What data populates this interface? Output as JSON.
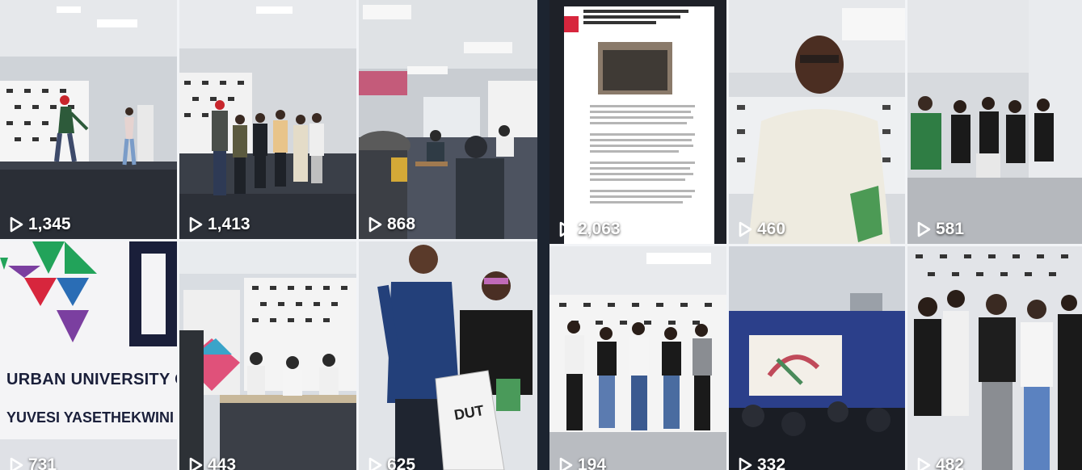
{
  "left_grid": {
    "tiles": [
      {
        "views": "1,345",
        "scene": "stage-performance"
      },
      {
        "views": "1,413",
        "scene": "stage-group"
      },
      {
        "views": "868",
        "scene": "classroom"
      },
      {
        "views": "731",
        "scene": "dut-logo",
        "banner_line1": "URBAN UNIVERSITY O",
        "banner_line2": "YUVESI YASETHEKWINI YE"
      },
      {
        "views": "443",
        "scene": "registration-table"
      },
      {
        "views": "625",
        "scene": "bag-presentation",
        "bag_text": "DUT"
      }
    ]
  },
  "right_grid": {
    "tiles": [
      {
        "views": "2,063",
        "scene": "article-screenshot"
      },
      {
        "views": "460",
        "scene": "speaker-closeup"
      },
      {
        "views": "581",
        "scene": "group-photo-1"
      },
      {
        "views": "194",
        "scene": "group-photo-2"
      },
      {
        "views": "332",
        "scene": "presentation-room"
      },
      {
        "views": "482",
        "scene": "group-photo-3"
      }
    ]
  },
  "colors": {
    "view_text": "#ffffff",
    "dut_red": "#d7263d",
    "dut_blue": "#2a6db5",
    "dut_green": "#22a35a",
    "dut_purple": "#7b3fa0",
    "background": "#1c2430"
  }
}
